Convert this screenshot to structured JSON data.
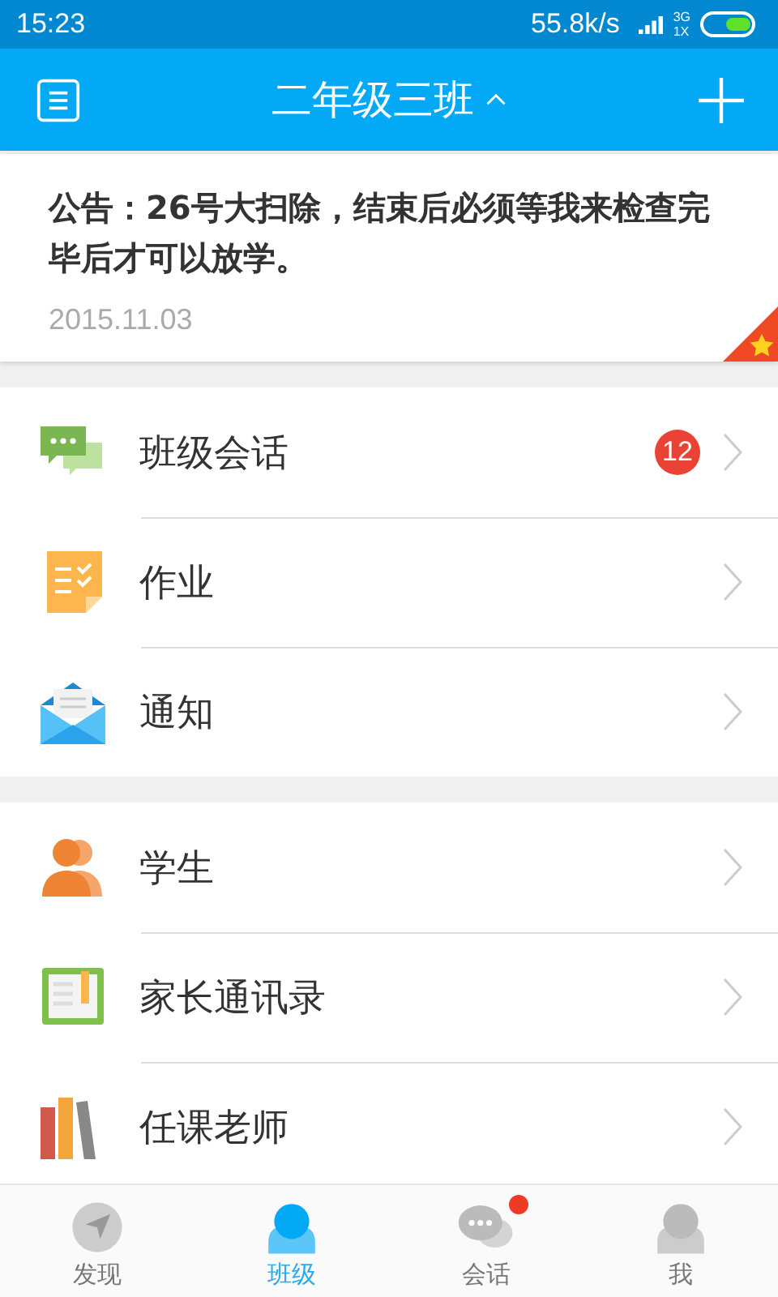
{
  "status_bar": {
    "time": "15:23",
    "speed": "55.8k/s",
    "network_top": "3G",
    "network_bottom": "1X"
  },
  "header": {
    "title": "二年级三班",
    "expanded": true
  },
  "notice": {
    "text": "公告：26号大扫除，结束后必须等我来检查完毕后才可以放学。",
    "date": "2015.11.03",
    "starred": true
  },
  "groups": [
    {
      "items": [
        {
          "label": "班级会话",
          "badge": "12"
        },
        {
          "label": "作业"
        },
        {
          "label": "通知"
        }
      ]
    },
    {
      "items": [
        {
          "label": "学生"
        },
        {
          "label": "家长通讯录"
        },
        {
          "label": "任课老师"
        }
      ]
    }
  ],
  "tab_bar": [
    {
      "label": "发现",
      "selected": false,
      "dot": false
    },
    {
      "label": "班级",
      "selected": true,
      "dot": false
    },
    {
      "label": "会话",
      "selected": false,
      "dot": true
    },
    {
      "label": "我",
      "selected": false,
      "dot": false
    }
  ]
}
